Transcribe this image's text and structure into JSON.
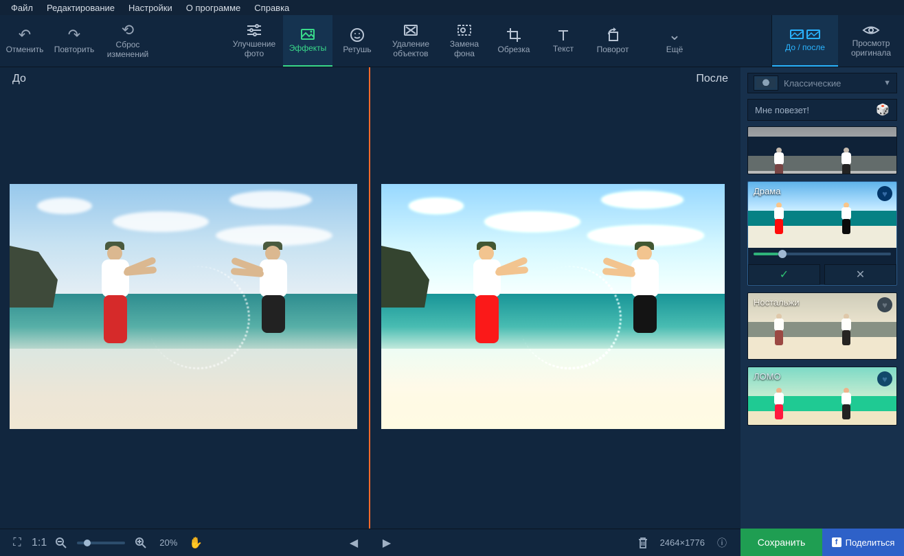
{
  "menu": {
    "file": "Файл",
    "edit": "Редактирование",
    "settings": "Настройки",
    "about": "О программе",
    "help": "Справка"
  },
  "toolbar": {
    "undo": "Отменить",
    "redo": "Повторить",
    "reset_line1": "Сброс",
    "reset_line2": "изменений",
    "enhance_line1": "Улучшение",
    "enhance_line2": "фото",
    "effects": "Эффекты",
    "retouch": "Ретушь",
    "removal_line1": "Удаление",
    "removal_line2": "объектов",
    "bg_line1": "Замена",
    "bg_line2": "фона",
    "crop": "Обрезка",
    "text": "Текст",
    "rotate": "Поворот",
    "more": "Ещё",
    "before_after": "До / после",
    "view_orig_line1": "Просмотр",
    "view_orig_line2": "оригинала"
  },
  "workspace": {
    "before": "До",
    "after": "После"
  },
  "panel": {
    "category": "Классические",
    "lucky": "Мне повезет!",
    "effects": {
      "drama": "Драма",
      "nostalgia": "Ностальжи",
      "lomo": "ЛОМО"
    }
  },
  "bottom": {
    "fit": "1:1",
    "zoom_pct": "20%",
    "dimensions": "2464×1776",
    "save": "Сохранить",
    "share": "Поделиться"
  }
}
